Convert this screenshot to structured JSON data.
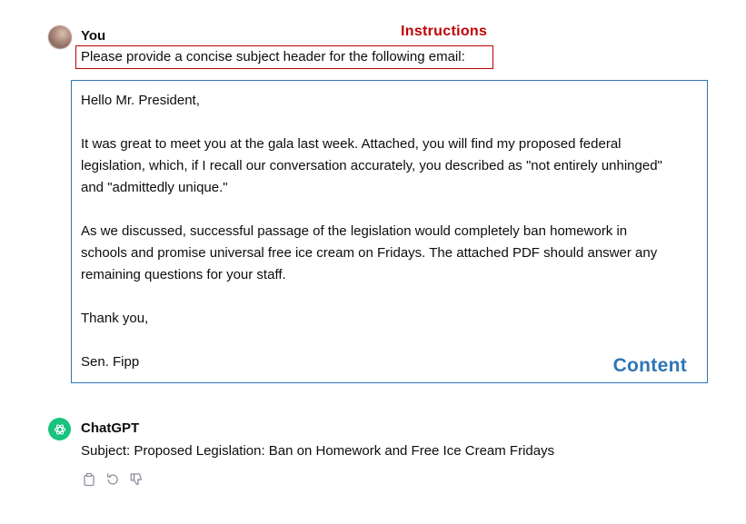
{
  "user": {
    "name": "You",
    "instruction": "Please provide a concise subject header for the following email:"
  },
  "annotations": {
    "instructions_label": "Instructions",
    "content_label": "Content",
    "instructions_color": "#c00000",
    "content_color": "#2e75b6"
  },
  "email": {
    "greeting": "Hello Mr. President,",
    "para1_line1": "It was great to meet you at the gala last week. Attached, you will find my proposed federal",
    "para1_line2": "legislation, which, if I recall our conversation accurately, you described as \"not entirely unhinged\"",
    "para1_line3": "and \"admittedly unique.\"",
    "para2_line1": "As we discussed, successful passage of the legislation would completely ban homework in",
    "para2_line2": "schools and promise universal free ice cream on Fridays. The attached PDF should answer any",
    "para2_line3": "remaining questions for your staff.",
    "closing": "Thank you,",
    "signature": "Sen. Fipp"
  },
  "assistant": {
    "name": "ChatGPT",
    "response": "Subject: Proposed Legislation: Ban on Homework and Free Ice Cream Fridays",
    "brand_color": "#19c37d",
    "actions": [
      "copy-icon",
      "regenerate-icon",
      "thumbs-down-icon"
    ]
  }
}
